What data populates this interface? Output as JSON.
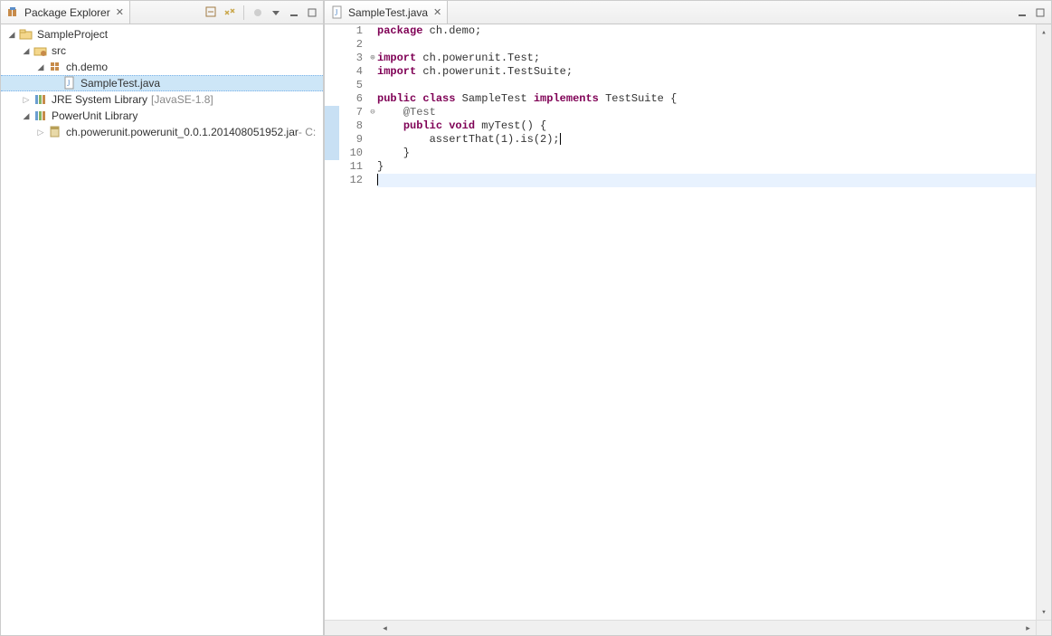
{
  "packageExplorer": {
    "title": "Package Explorer",
    "tree": {
      "project": "SampleProject",
      "src": "src",
      "pkg": "ch.demo",
      "file": "SampleTest.java",
      "jre": "JRE System Library",
      "jreDecor": "[JavaSE-1.8]",
      "powerunit": "PowerUnit Library",
      "jar": "ch.powerunit.powerunit_0.0.1.201408051952.jar",
      "jarDecor": " - C:"
    }
  },
  "editor": {
    "tabTitle": "SampleTest.java",
    "lineNumbers": [
      "1",
      "2",
      "3",
      "4",
      "5",
      "6",
      "7",
      "8",
      "9",
      "10",
      "11",
      "12"
    ],
    "code": {
      "l1_kw": "package",
      "l1_rest": " ch.demo;",
      "l3_kw": "import",
      "l3_rest": " ch.powerunit.Test;",
      "l4_kw": "import",
      "l4_rest": " ch.powerunit.TestSuite;",
      "l6_kw1": "public",
      "l6_kw2": "class",
      "l6_name": " SampleTest ",
      "l6_kw3": "implements",
      "l6_rest": " TestSuite {",
      "l7_ann": "    @Test",
      "l8_kw1": "public",
      "l8_kw2": "void",
      "l8_rest": " myTest() {",
      "l9": "        assertThat(1).is(2);",
      "l10": "    }",
      "l11": "}",
      "l12": ""
    }
  }
}
